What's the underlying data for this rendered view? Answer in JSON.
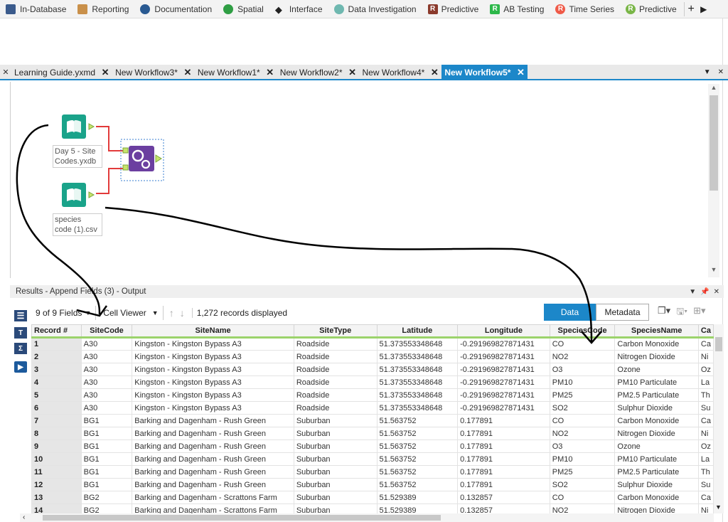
{
  "toolbar": {
    "categories": [
      {
        "label": "In-Database",
        "icon": "database-icon",
        "color": "#3b5b8c"
      },
      {
        "label": "Reporting",
        "icon": "report-icon",
        "color": "#c9904a"
      },
      {
        "label": "Documentation",
        "icon": "comment-icon",
        "color": "#2a5a92"
      },
      {
        "label": "Spatial",
        "icon": "spatial-icon",
        "color": "#2f9e44"
      },
      {
        "label": "Interface",
        "icon": "interface-icon",
        "color": "#222222"
      },
      {
        "label": "Data Investigation",
        "icon": "investigation-icon",
        "color": "#6fb8b0"
      },
      {
        "label": "Predictive",
        "icon": "r-badge-icon",
        "badge": "R",
        "color": "#8b3a2c"
      },
      {
        "label": "AB Testing",
        "icon": "r-badge-icon",
        "badge": "R",
        "color": "#2db84a"
      },
      {
        "label": "Time Series",
        "icon": "r-circle-icon",
        "badge": "R",
        "color": "#ef5a48"
      },
      {
        "label": "Predictive",
        "icon": "r-circle-icon",
        "badge": "R",
        "color": "#7ab648"
      }
    ],
    "add": "+",
    "next": "▶"
  },
  "tabs": [
    {
      "label": "Learning Guide.yxmd",
      "active": false
    },
    {
      "label": "New Workflow3*",
      "active": false
    },
    {
      "label": "New Workflow1*",
      "active": false
    },
    {
      "label": "New Workflow2*",
      "active": false
    },
    {
      "label": "New Workflow4*",
      "active": false
    },
    {
      "label": "New Workflow5*",
      "active": true
    }
  ],
  "tab_close": "✕",
  "canvas": {
    "tool1_label": "Day 5 - Site Codes.yxdb",
    "tool2_label": "species code (1).csv",
    "tool3_name": "append-fields-tool"
  },
  "results": {
    "header": "Results - Append Fields (3) - Output",
    "fields": "9 of 9 Fields",
    "viewer": "Cell Viewer",
    "records": "1,272 records displayed",
    "data_btn": "Data",
    "meta_btn": "Metadata"
  },
  "sidebar": {
    "t": "T",
    "s": "Σ"
  },
  "grid": {
    "columns": [
      "Record #",
      "SiteCode",
      "SiteName",
      "SiteType",
      "Latitude",
      "Longitude",
      "SpeciesCode",
      "SpeciesName",
      "Ca"
    ],
    "rows": [
      [
        "1",
        "A30",
        "Kingston - Kingston Bypass A3",
        "Roadside",
        "51.373553348648",
        "-0.291969827871431",
        "CO",
        "Carbon Monoxide",
        "Ca"
      ],
      [
        "2",
        "A30",
        "Kingston - Kingston Bypass A3",
        "Roadside",
        "51.373553348648",
        "-0.291969827871431",
        "NO2",
        "Nitrogen Dioxide",
        "Ni"
      ],
      [
        "3",
        "A30",
        "Kingston - Kingston Bypass A3",
        "Roadside",
        "51.373553348648",
        "-0.291969827871431",
        "O3",
        "Ozone",
        "Oz"
      ],
      [
        "4",
        "A30",
        "Kingston - Kingston Bypass A3",
        "Roadside",
        "51.373553348648",
        "-0.291969827871431",
        "PM10",
        "PM10 Particulate",
        "La"
      ],
      [
        "5",
        "A30",
        "Kingston - Kingston Bypass A3",
        "Roadside",
        "51.373553348648",
        "-0.291969827871431",
        "PM25",
        "PM2.5 Particulate",
        "Th"
      ],
      [
        "6",
        "A30",
        "Kingston - Kingston Bypass A3",
        "Roadside",
        "51.373553348648",
        "-0.291969827871431",
        "SO2",
        "Sulphur Dioxide",
        "Su"
      ],
      [
        "7",
        "BG1",
        "Barking and Dagenham - Rush Green",
        "Suburban",
        "51.563752",
        "0.177891",
        "CO",
        "Carbon Monoxide",
        "Ca"
      ],
      [
        "8",
        "BG1",
        "Barking and Dagenham - Rush Green",
        "Suburban",
        "51.563752",
        "0.177891",
        "NO2",
        "Nitrogen Dioxide",
        "Ni"
      ],
      [
        "9",
        "BG1",
        "Barking and Dagenham - Rush Green",
        "Suburban",
        "51.563752",
        "0.177891",
        "O3",
        "Ozone",
        "Oz"
      ],
      [
        "10",
        "BG1",
        "Barking and Dagenham - Rush Green",
        "Suburban",
        "51.563752",
        "0.177891",
        "PM10",
        "PM10 Particulate",
        "La"
      ],
      [
        "11",
        "BG1",
        "Barking and Dagenham - Rush Green",
        "Suburban",
        "51.563752",
        "0.177891",
        "PM25",
        "PM2.5 Particulate",
        "Th"
      ],
      [
        "12",
        "BG1",
        "Barking and Dagenham - Rush Green",
        "Suburban",
        "51.563752",
        "0.177891",
        "SO2",
        "Sulphur Dioxide",
        "Su"
      ],
      [
        "13",
        "BG2",
        "Barking and Dagenham - Scrattons Farm",
        "Suburban",
        "51.529389",
        "0.132857",
        "CO",
        "Carbon Monoxide",
        "Ca"
      ],
      [
        "14",
        "BG2",
        "Barking and Dagenham - Scrattons Farm",
        "Suburban",
        "51.529389",
        "0.132857",
        "NO2",
        "Nitrogen Dioxide",
        "Ni"
      ]
    ]
  }
}
